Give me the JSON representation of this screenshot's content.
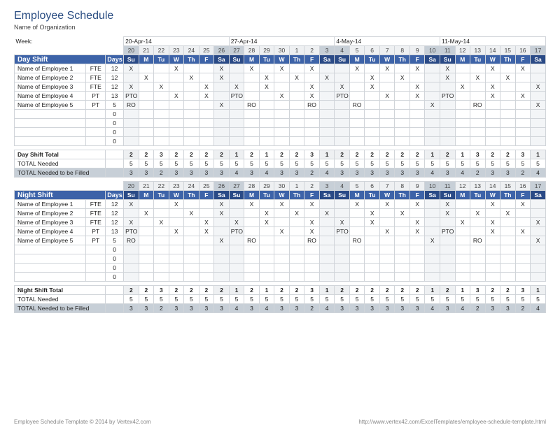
{
  "title": "Employee Schedule",
  "org": "Name of Organization",
  "week_label": "Week:",
  "weeks": [
    "20-Apr-14",
    "27-Apr-14",
    "4-May-14",
    "11-May-14"
  ],
  "day_nums": [
    "20",
    "21",
    "22",
    "23",
    "24",
    "25",
    "26",
    "27",
    "28",
    "29",
    "30",
    "1",
    "2",
    "3",
    "4",
    "5",
    "6",
    "7",
    "8",
    "9",
    "10",
    "11",
    "12",
    "13",
    "14",
    "15",
    "16",
    "17"
  ],
  "dows": [
    "Su",
    "M",
    "Tu",
    "W",
    "Th",
    "F",
    "Sa",
    "Su",
    "M",
    "Tu",
    "W",
    "Th",
    "F",
    "Sa",
    "Su",
    "M",
    "Tu",
    "W",
    "Th",
    "F",
    "Sa",
    "Su",
    "M",
    "Tu",
    "W",
    "Th",
    "F",
    "Sa"
  ],
  "days_header": "Days",
  "shifts": [
    {
      "name": "Day Shift",
      "employees": [
        {
          "name": "Name of Employee 1",
          "type": "FTE",
          "days": "12",
          "row": [
            "X",
            "",
            "",
            "X",
            "",
            "",
            "X",
            "",
            "X",
            "",
            "X",
            "",
            "X",
            "",
            "",
            "X",
            "",
            "X",
            "",
            "X",
            "",
            "X",
            "",
            "",
            "X",
            "",
            "X",
            ""
          ]
        },
        {
          "name": "Name of Employee 2",
          "type": "FTE",
          "days": "12",
          "row": [
            "",
            "X",
            "",
            "",
            "X",
            "",
            "X",
            "",
            "",
            "X",
            "",
            "X",
            "",
            "X",
            "",
            "",
            "X",
            "",
            "X",
            "",
            "",
            "X",
            "",
            "X",
            "",
            "X",
            "",
            ""
          ]
        },
        {
          "name": "Name of Employee 3",
          "type": "FTE",
          "days": "12",
          "row": [
            "X",
            "",
            "X",
            "",
            "",
            "X",
            "",
            "X",
            "",
            "X",
            "",
            "",
            "X",
            "",
            "X",
            "",
            "X",
            "",
            "",
            "X",
            "",
            "",
            "X",
            "",
            "X",
            "",
            "",
            "X"
          ]
        },
        {
          "name": "Name of Employee 4",
          "type": "PT",
          "days": "13",
          "row": [
            "PTO",
            "",
            "",
            "X",
            "",
            "X",
            "",
            "PTO",
            "",
            "",
            "X",
            "",
            "X",
            "",
            "PTO",
            "",
            "",
            "X",
            "",
            "X",
            "",
            "PTO",
            "",
            "",
            "X",
            "",
            "X",
            ""
          ]
        },
        {
          "name": "Name of Employee 5",
          "type": "PT",
          "days": "5",
          "row": [
            "RO",
            "",
            "",
            "",
            "",
            "",
            "X",
            "",
            "RO",
            "",
            "",
            "",
            "RO",
            "",
            "",
            "RO",
            "",
            "",
            "",
            "",
            "X",
            "",
            "",
            "RO",
            "",
            "",
            "",
            "X"
          ]
        }
      ],
      "blank_rows": 4,
      "totals": {
        "label1": "Day Shift Total",
        "row1": [
          "2",
          "2",
          "3",
          "2",
          "2",
          "2",
          "2",
          "1",
          "2",
          "1",
          "2",
          "2",
          "3",
          "1",
          "2",
          "2",
          "2",
          "2",
          "2",
          "2",
          "1",
          "2",
          "1",
          "3",
          "2",
          "2",
          "3",
          "1"
        ],
        "label2": "TOTAL Needed",
        "row2": [
          "5",
          "5",
          "5",
          "5",
          "5",
          "5",
          "5",
          "5",
          "5",
          "5",
          "5",
          "5",
          "5",
          "5",
          "5",
          "5",
          "5",
          "5",
          "5",
          "5",
          "5",
          "5",
          "5",
          "5",
          "5",
          "5",
          "5",
          "5"
        ],
        "label3": "TOTAL Needed to be Filled",
        "row3": [
          "3",
          "3",
          "2",
          "3",
          "3",
          "3",
          "3",
          "4",
          "3",
          "4",
          "3",
          "3",
          "2",
          "4",
          "3",
          "3",
          "3",
          "3",
          "3",
          "3",
          "4",
          "3",
          "4",
          "2",
          "3",
          "3",
          "2",
          "4"
        ]
      }
    },
    {
      "name": "Night Shift",
      "employees": [
        {
          "name": "Name of Employee 1",
          "type": "FTE",
          "days": "12",
          "row": [
            "X",
            "",
            "",
            "X",
            "",
            "",
            "X",
            "",
            "X",
            "",
            "X",
            "",
            "X",
            "",
            "",
            "X",
            "",
            "X",
            "",
            "X",
            "",
            "X",
            "",
            "",
            "X",
            "",
            "X",
            ""
          ]
        },
        {
          "name": "Name of Employee 2",
          "type": "FTE",
          "days": "12",
          "row": [
            "",
            "X",
            "",
            "",
            "X",
            "",
            "X",
            "",
            "",
            "X",
            "",
            "X",
            "",
            "X",
            "",
            "",
            "X",
            "",
            "X",
            "",
            "",
            "X",
            "",
            "X",
            "",
            "X",
            "",
            ""
          ]
        },
        {
          "name": "Name of Employee 3",
          "type": "FTE",
          "days": "12",
          "row": [
            "X",
            "",
            "X",
            "",
            "",
            "X",
            "",
            "X",
            "",
            "X",
            "",
            "",
            "X",
            "",
            "X",
            "",
            "X",
            "",
            "",
            "X",
            "",
            "",
            "X",
            "",
            "X",
            "",
            "",
            "X"
          ]
        },
        {
          "name": "Name of Employee 4",
          "type": "PT",
          "days": "13",
          "row": [
            "PTO",
            "",
            "",
            "X",
            "",
            "X",
            "",
            "PTO",
            "",
            "",
            "X",
            "",
            "X",
            "",
            "PTO",
            "",
            "",
            "X",
            "",
            "X",
            "",
            "PTO",
            "",
            "",
            "X",
            "",
            "X",
            ""
          ]
        },
        {
          "name": "Name of Employee 5",
          "type": "PT",
          "days": "5",
          "row": [
            "RO",
            "",
            "",
            "",
            "",
            "",
            "X",
            "",
            "RO",
            "",
            "",
            "",
            "RO",
            "",
            "",
            "RO",
            "",
            "",
            "",
            "",
            "X",
            "",
            "",
            "RO",
            "",
            "",
            "",
            "X"
          ]
        }
      ],
      "blank_rows": 4,
      "totals": {
        "label1": "Night Shift Total",
        "row1": [
          "2",
          "2",
          "3",
          "2",
          "2",
          "2",
          "2",
          "1",
          "2",
          "1",
          "2",
          "2",
          "3",
          "1",
          "2",
          "2",
          "2",
          "2",
          "2",
          "2",
          "1",
          "2",
          "1",
          "3",
          "2",
          "2",
          "3",
          "1"
        ],
        "label2": "TOTAL Needed",
        "row2": [
          "5",
          "5",
          "5",
          "5",
          "5",
          "5",
          "5",
          "5",
          "5",
          "5",
          "5",
          "5",
          "5",
          "5",
          "5",
          "5",
          "5",
          "5",
          "5",
          "5",
          "5",
          "5",
          "5",
          "5",
          "5",
          "5",
          "5",
          "5"
        ],
        "label3": "TOTAL Needed to be Filled",
        "row3": [
          "3",
          "3",
          "2",
          "3",
          "3",
          "3",
          "3",
          "4",
          "3",
          "4",
          "3",
          "3",
          "2",
          "4",
          "3",
          "3",
          "3",
          "3",
          "3",
          "3",
          "4",
          "3",
          "4",
          "2",
          "3",
          "3",
          "2",
          "4"
        ]
      }
    }
  ],
  "footer_left": "Employee Schedule Template © 2014 by Vertex42.com",
  "footer_right": "http://www.vertex42.com/ExcelTemplates/employee-schedule-template.html"
}
